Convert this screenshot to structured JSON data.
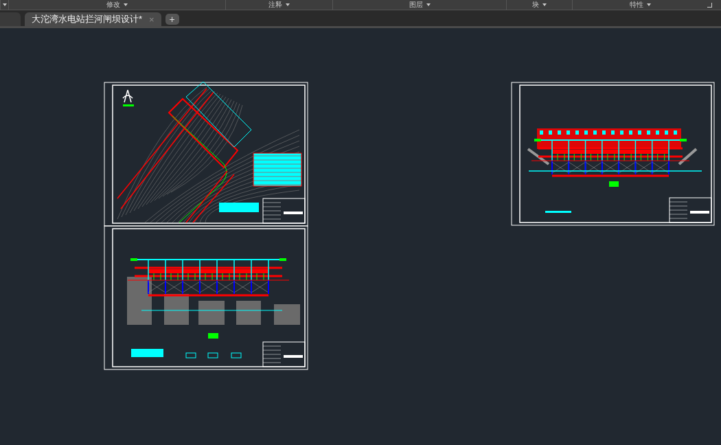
{
  "ribbon_panels": [
    {
      "label": "修改"
    },
    {
      "label": "注释"
    },
    {
      "label": "图层"
    },
    {
      "label": "块"
    },
    {
      "label": "特性"
    }
  ],
  "file_tabs": [
    {
      "selected": false
    },
    {
      "label": "大沱湾水电站拦河闸坝设计*",
      "selected": true,
      "close": "×"
    }
  ],
  "new_tab_button": "+",
  "sheets": [
    {
      "kind": "site_plan"
    },
    {
      "kind": "front_elevation"
    },
    {
      "kind": "side_elevation"
    }
  ]
}
